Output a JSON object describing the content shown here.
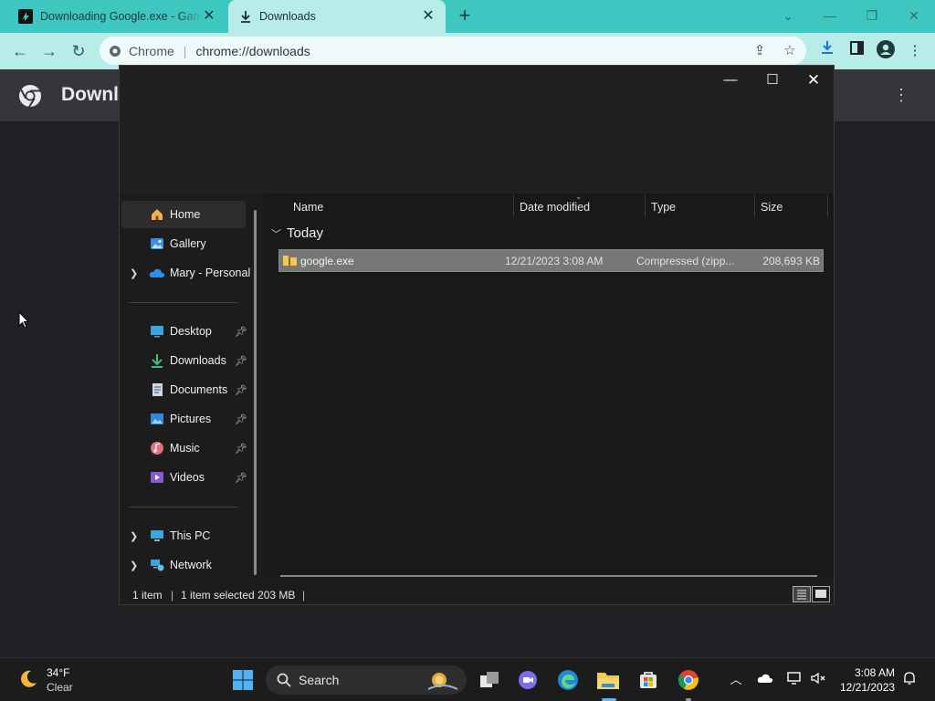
{
  "browser": {
    "tabs": [
      {
        "title": "Downloading Google.exe - Gam",
        "icon": "game-site-favicon"
      },
      {
        "title": "Downloads",
        "icon": "download-icon"
      }
    ],
    "omnibox": {
      "chip": "Chrome",
      "url": "chrome://downloads"
    },
    "page_title": "Downl",
    "colors": {
      "tabbar": "#3ec7c1",
      "toolbar": "#b7ece9",
      "page_bg": "#202124"
    }
  },
  "explorer": {
    "nav": {
      "home": "Home",
      "gallery": "Gallery",
      "onedrive": "Mary - Personal",
      "desktop": "Desktop",
      "downloads": "Downloads",
      "documents": "Documents",
      "pictures": "Pictures",
      "music": "Music",
      "videos": "Videos",
      "this_pc": "This PC",
      "network": "Network"
    },
    "columns": {
      "name": "Name",
      "date": "Date modified",
      "type": "Type",
      "size": "Size"
    },
    "group": "Today",
    "file": {
      "name": "google.exe",
      "date": "12/21/2023 3:08 AM",
      "type": "Compressed (zipp...",
      "size": "208,693 KB"
    },
    "status": {
      "count": "1 item",
      "selected": "1 item selected  203 MB"
    }
  },
  "taskbar": {
    "weather": {
      "temp": "34°F",
      "desc": "Clear"
    },
    "search_placeholder": "Search",
    "clock": {
      "time": "3:08 AM",
      "date": "12/21/2023"
    }
  }
}
